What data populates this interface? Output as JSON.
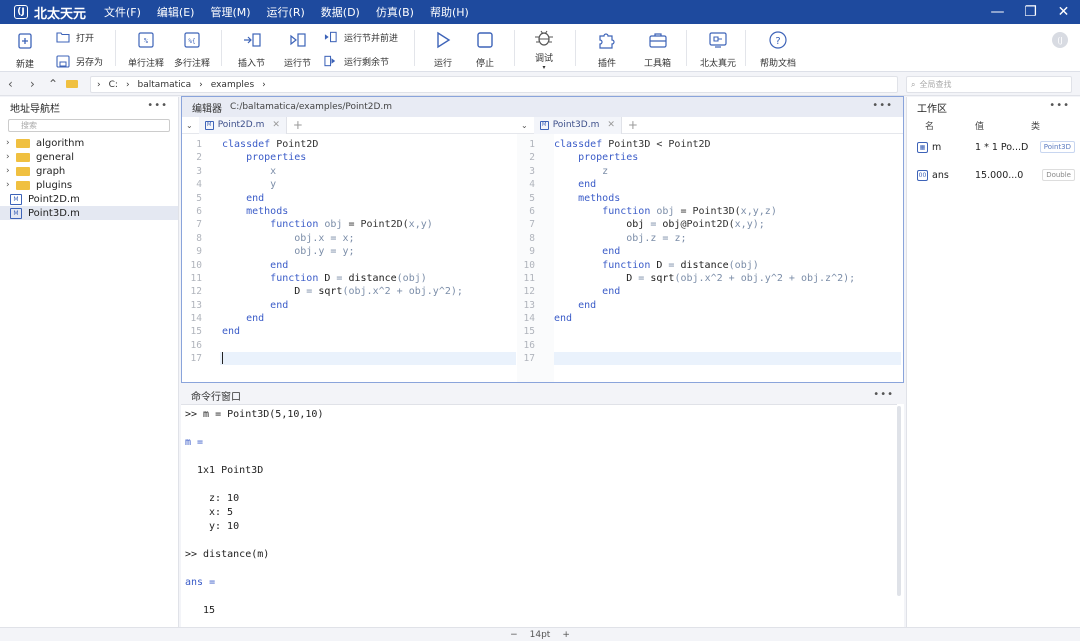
{
  "app": {
    "logo_text": "北太天元",
    "logo_mark": "(J"
  },
  "menu": [
    "文件(F)",
    "编辑(E)",
    "管理(M)",
    "运行(R)",
    "数据(D)",
    "仿真(B)",
    "帮助(H)"
  ],
  "toolbar": {
    "new": "新建",
    "open": "打开",
    "save_as": "另存为",
    "single_comment": "单行注释",
    "multi_comment": "多行注释",
    "insert_section": "插入节",
    "run_section": "运行节",
    "run_section_advance": "运行节并前进",
    "run_remaining": "运行剩余节",
    "run": "运行",
    "stop": "停止",
    "debug": "调试",
    "plugins": "插件",
    "toolbox": "工具箱",
    "beitai_sim": "北太真元",
    "help_docs": "帮助文档"
  },
  "addressbar": {
    "path": [
      "C:",
      "baltamatica",
      "examples"
    ],
    "global_search_placeholder": "全局查找"
  },
  "left_panel": {
    "title": "地址导航栏",
    "search_placeholder": "搜索",
    "items": [
      {
        "name": "algorithm",
        "type": "folder"
      },
      {
        "name": "general",
        "type": "folder"
      },
      {
        "name": "graph",
        "type": "folder"
      },
      {
        "name": "plugins",
        "type": "folder"
      },
      {
        "name": "Point2D.m",
        "type": "file"
      },
      {
        "name": "Point3D.m",
        "type": "file"
      }
    ]
  },
  "editor": {
    "title": "编辑器",
    "path": "C:/baltamatica/examples/Point2D.m",
    "tabs": [
      {
        "label": "Point2D.m"
      },
      {
        "label": "Point3D.m"
      }
    ],
    "left_code": [
      "classdef Point2D",
      "    properties",
      "        x",
      "        y",
      "    end",
      "    methods",
      "        function obj = Point2D(x,y)",
      "            obj.x = x;",
      "            obj.y = y;",
      "        end",
      "        function D = distance(obj)",
      "            D = sqrt(obj.x^2 + obj.y^2);",
      "        end",
      "    end",
      "end",
      "",
      ""
    ],
    "right_code": [
      "classdef Point3D < Point2D",
      "    properties",
      "        z",
      "    end",
      "    methods",
      "        function obj = Point3D(x,y,z)",
      "            obj = obj@Point2D(x,y);",
      "            obj.z = z;",
      "        end",
      "        function D = distance(obj)",
      "            D = sqrt(obj.x^2 + obj.y^2 + obj.z^2);",
      "        end",
      "    end",
      "end",
      "",
      "",
      ""
    ]
  },
  "command_window": {
    "title": "命令行窗口",
    "lines": [
      ">> m = Point3D(5,10,10)",
      "m =",
      "1x1 Point3D",
      "z: 10",
      "x: 5",
      "y: 10",
      ">> distance(m)",
      "ans =",
      "15"
    ]
  },
  "workspace": {
    "title": "工作区",
    "columns": [
      "名",
      "值",
      "类"
    ],
    "rows": [
      {
        "name": "m",
        "value": "1 * 1 Po...D",
        "class": "Point3D"
      },
      {
        "name": "ans",
        "value": "15.000...0",
        "class": "Double"
      }
    ]
  },
  "statusbar": {
    "minus": "−",
    "zoom": "14pt",
    "plus": "+"
  },
  "colors": {
    "titlebar": "#1e4a9e",
    "accent": "#3d63b8",
    "keyword": "#3b5cc8"
  }
}
